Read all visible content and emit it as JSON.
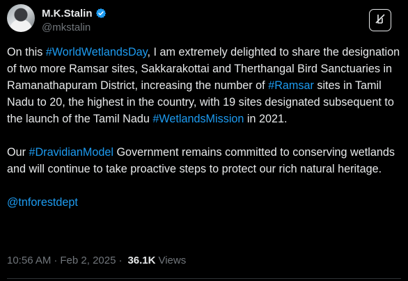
{
  "author": {
    "display_name": "M.K.Stalin",
    "handle": "@mkstalin",
    "verified": true,
    "verified_color": "#1d9bf0"
  },
  "actions": {
    "grok_icon": "grok-icon",
    "more_icon": "more-icon"
  },
  "tweet": {
    "p1": {
      "t1": "On this ",
      "h1": "#WorldWetlandsDay",
      "t2": ", I am extremely delighted to share the designation of two more Ramsar sites, Sakkarakottai and Therthangal Bird Sanctuaries in Ramanathapuram District, increasing the number of ",
      "h2": "#Ramsar",
      "t3": " sites in Tamil Nadu to 20, the highest in the country, with 19 sites designated subsequent to the launch of the Tamil Nadu ",
      "h3": "#WetlandsMission",
      "t4": " in 2021."
    },
    "p2": {
      "t1": "Our ",
      "h1": "#DravidianModel",
      "t2": " Government remains committed to conserving wetlands and will continue to take proactive steps to protect our rich natural heritage."
    },
    "p3": {
      "mention": "@tnforestdept"
    }
  },
  "meta": {
    "time": "10:56 AM",
    "separator": "·",
    "date": "Feb 2, 2025",
    "views_separator": "·",
    "views_count": "36.1K",
    "views_label": "Views"
  },
  "colors": {
    "background": "#000000",
    "text": "#e7e9ea",
    "link": "#1d9bf0",
    "muted": "#71767b"
  }
}
